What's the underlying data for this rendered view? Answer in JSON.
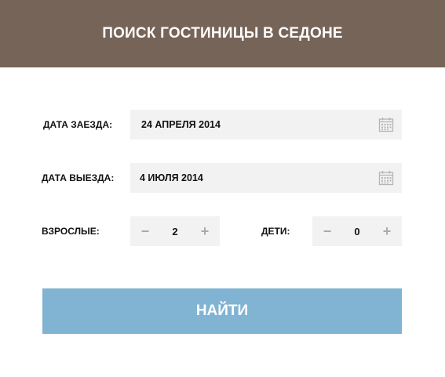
{
  "header": {
    "title": "ПОИСК ГОСТИНИЦЫ В СЕДОНЕ"
  },
  "checkin": {
    "label": "ДАТА ЗАЕЗДА:",
    "value": "24 АПРЕЛЯ 2014",
    "icon": "calendar-icon"
  },
  "checkout": {
    "label": "ДАТА ВЫЕЗДА:",
    "value": "4 ИЮЛЯ 2014",
    "icon": "calendar-icon"
  },
  "adults": {
    "label": "ВЗРОСЛЫЕ:",
    "minus": "−",
    "value": "2",
    "plus": "+"
  },
  "children": {
    "label": "ДЕТИ:",
    "minus": "−",
    "value": "0",
    "plus": "+"
  },
  "search_button": {
    "label": "НАЙТИ"
  },
  "colors": {
    "header_bg": "#776458",
    "field_bg": "#f2f2f2",
    "button_bg": "#81b3d3",
    "icon": "#aaaaaa"
  }
}
